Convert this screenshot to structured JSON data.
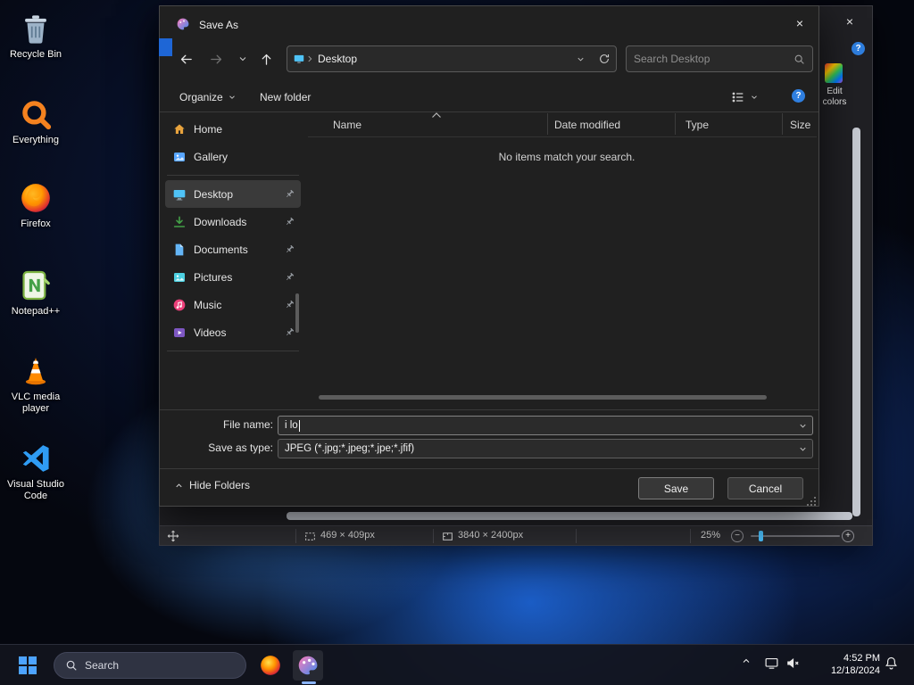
{
  "icons_glyphs": {
    "close": "×",
    "help": "?",
    "zoom_in": "+",
    "zoom_out": "−"
  },
  "desktop": {
    "icons": [
      {
        "label": "Recycle Bin"
      },
      {
        "label": "Everything"
      },
      {
        "label": "Firefox"
      },
      {
        "label": "Notepad++"
      },
      {
        "label": "VLC media player"
      },
      {
        "label": "Visual Studio Code"
      }
    ]
  },
  "dialog": {
    "title": "Save As",
    "nav": {
      "breadcrumb_root": "Desktop",
      "search_placeholder": "Search Desktop"
    },
    "toolbar": {
      "organize_label": "Organize",
      "new_folder_label": "New folder"
    },
    "sidebar": {
      "items": [
        {
          "label": "Home"
        },
        {
          "label": "Gallery"
        },
        {
          "label": "Desktop"
        },
        {
          "label": "Downloads"
        },
        {
          "label": "Documents"
        },
        {
          "label": "Pictures"
        },
        {
          "label": "Music"
        },
        {
          "label": "Videos"
        }
      ]
    },
    "file_list": {
      "columns": [
        "Name",
        "Date modified",
        "Type",
        "Size"
      ],
      "empty_text": "No items match your search."
    },
    "fields": {
      "file_name_label": "File name:",
      "file_name_value": "i lo",
      "save_type_label": "Save as type:",
      "save_type_value": "JPEG (*.jpg;*.jpeg;*.jpe;*.jfif)"
    },
    "footer": {
      "hide_folders_label": "Hide Folders",
      "save_label": "Save",
      "cancel_label": "Cancel"
    }
  },
  "paint": {
    "edit_colors_label": "Edit colors",
    "status": {
      "selection_size": "469 × 409px",
      "image_size": "3840 × 2400px",
      "zoom_level": "25%"
    }
  },
  "taskbar": {
    "search_placeholder": "Search",
    "time": "4:52 PM",
    "date": "12/18/2024"
  },
  "colors": {
    "accent": "#4cc2ff",
    "window_bg": "#202020"
  }
}
